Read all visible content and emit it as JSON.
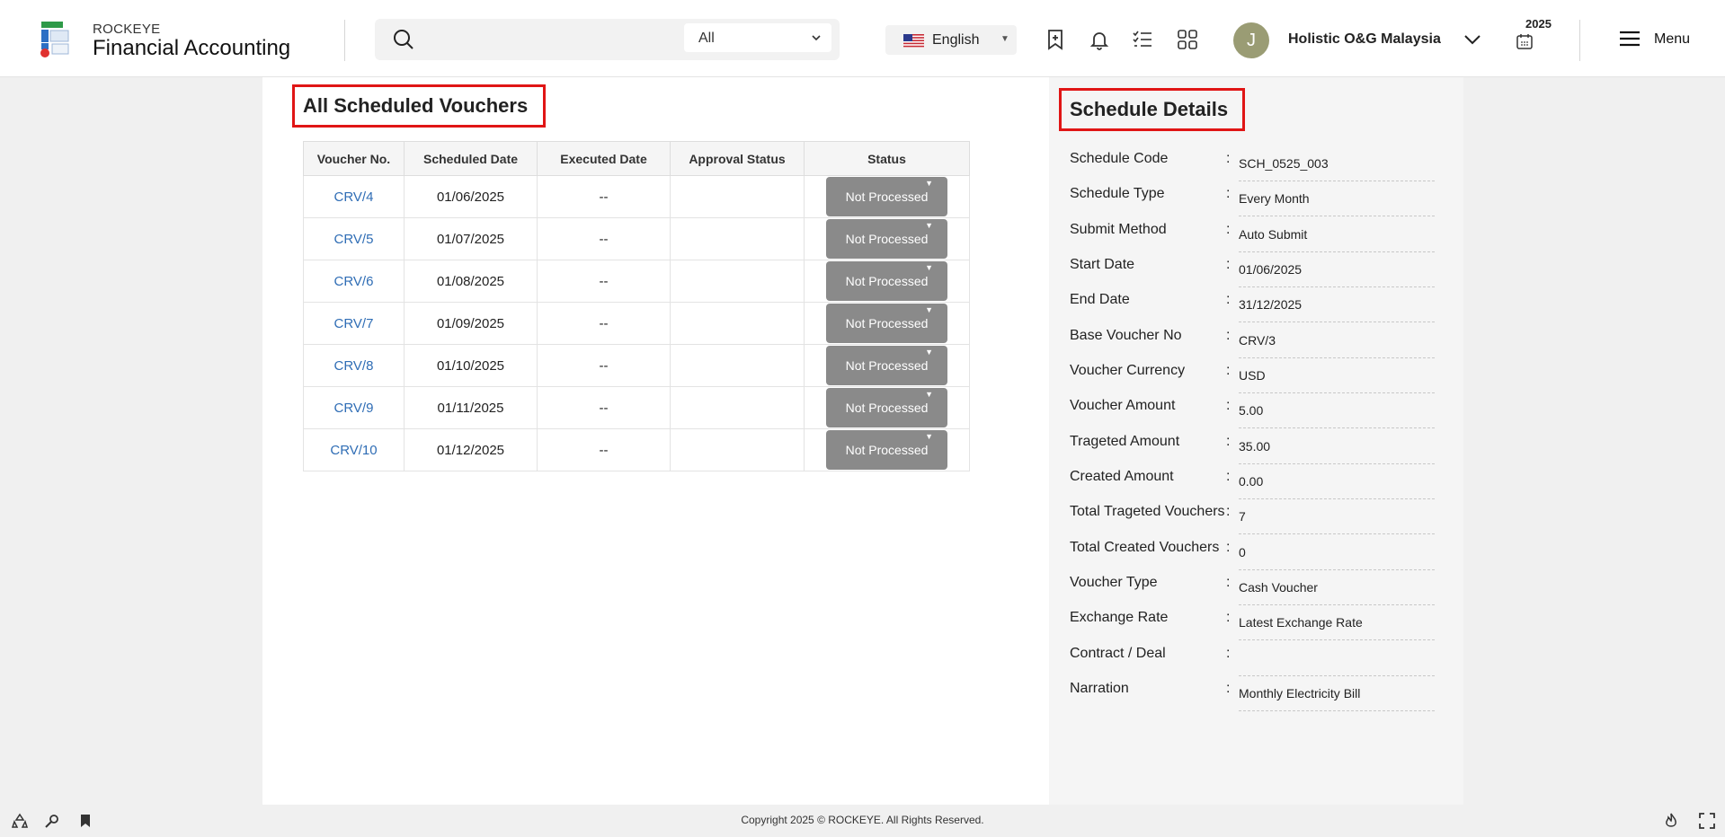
{
  "header": {
    "brand_small": "ROCKEYE",
    "brand_name": "Financial Accounting",
    "search_placeholder": "",
    "search_filter": "All",
    "language": "English",
    "avatar_initial": "J",
    "company": "Holistic O&G Malaysia",
    "year": "2025",
    "menu_label": "Menu"
  },
  "main": {
    "title": "All Scheduled Vouchers",
    "columns": [
      "Voucher No.",
      "Scheduled Date",
      "Executed Date",
      "Approval Status",
      "Status"
    ],
    "rows": [
      {
        "voucher": "CRV/4",
        "scheduled": "01/06/2025",
        "executed": "--",
        "approval": "",
        "status": "Not Processed"
      },
      {
        "voucher": "CRV/5",
        "scheduled": "01/07/2025",
        "executed": "--",
        "approval": "",
        "status": "Not Processed"
      },
      {
        "voucher": "CRV/6",
        "scheduled": "01/08/2025",
        "executed": "--",
        "approval": "",
        "status": "Not Processed"
      },
      {
        "voucher": "CRV/7",
        "scheduled": "01/09/2025",
        "executed": "--",
        "approval": "",
        "status": "Not Processed"
      },
      {
        "voucher": "CRV/8",
        "scheduled": "01/10/2025",
        "executed": "--",
        "approval": "",
        "status": "Not Processed"
      },
      {
        "voucher": "CRV/9",
        "scheduled": "01/11/2025",
        "executed": "--",
        "approval": "",
        "status": "Not Processed"
      },
      {
        "voucher": "CRV/10",
        "scheduled": "01/12/2025",
        "executed": "--",
        "approval": "",
        "status": "Not Processed"
      }
    ]
  },
  "details": {
    "title": "Schedule Details",
    "fields": [
      {
        "label": "Schedule Code",
        "value": "SCH_0525_003"
      },
      {
        "label": "Schedule Type",
        "value": "Every Month"
      },
      {
        "label": "Submit Method",
        "value": "Auto Submit"
      },
      {
        "label": "Start Date",
        "value": "01/06/2025"
      },
      {
        "label": "End Date",
        "value": "31/12/2025"
      },
      {
        "label": "Base Voucher No",
        "value": "CRV/3"
      },
      {
        "label": "Voucher Currency",
        "value": "USD"
      },
      {
        "label": "Voucher Amount",
        "value": "5.00"
      },
      {
        "label": "Trageted Amount",
        "value": "35.00"
      },
      {
        "label": "Created Amount",
        "value": "0.00"
      },
      {
        "label": "Total Trageted Vouchers",
        "value": "7"
      },
      {
        "label": "Total Created Vouchers",
        "value": "0"
      },
      {
        "label": "Voucher Type",
        "value": "Cash Voucher"
      },
      {
        "label": "Exchange Rate",
        "value": "Latest Exchange Rate"
      },
      {
        "label": "Contract / Deal",
        "value": ""
      },
      {
        "label": "Narration",
        "value": "Monthly Electricity Bill"
      }
    ]
  },
  "footer": {
    "copyright": "Copyright 2025 © ROCKEYE. All Rights Reserved."
  },
  "colors": {
    "accent_link": "#2f6db5",
    "highlight_border": "#e01515",
    "status_button": "#8a8a8a"
  }
}
